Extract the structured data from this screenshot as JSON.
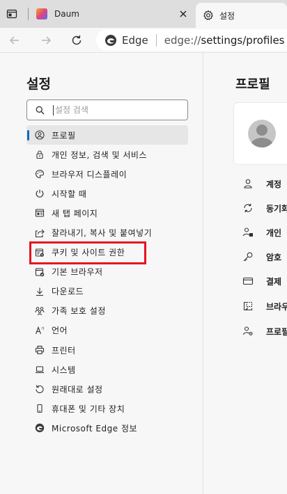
{
  "tabs": [
    {
      "title": "Daum"
    },
    {
      "title": "설정"
    }
  ],
  "address_bar": {
    "badge": "Edge",
    "url_scheme": "edge://",
    "url_rest": "settings/profiles"
  },
  "sidebar": {
    "title": "설정",
    "search_placeholder": "설정 검색",
    "items": [
      {
        "label": "프로필",
        "icon": "profile-icon",
        "active": true
      },
      {
        "label": "개인 정보, 검색 및 서비스",
        "icon": "lock-icon"
      },
      {
        "label": "브라우저 디스플레이",
        "icon": "palette-icon"
      },
      {
        "label": "시작할 때",
        "icon": "power-icon"
      },
      {
        "label": "새 탭 페이지",
        "icon": "new-tab-icon"
      },
      {
        "label": "잘라내기, 복사 및 붙여넣기",
        "icon": "share-icon"
      },
      {
        "label": "쿠키 및 사이트 권한",
        "icon": "site-permissions-icon",
        "highlighted": true
      },
      {
        "label": "기본 브라우저",
        "icon": "default-browser-icon"
      },
      {
        "label": "다운로드",
        "icon": "download-icon"
      },
      {
        "label": "가족 보호 설정",
        "icon": "family-icon"
      },
      {
        "label": "언어",
        "icon": "language-icon"
      },
      {
        "label": "프린터",
        "icon": "printer-icon"
      },
      {
        "label": "시스템",
        "icon": "laptop-icon"
      },
      {
        "label": "원래대로 설정",
        "icon": "reset-icon"
      },
      {
        "label": "휴대폰 및 기타 장치",
        "icon": "phone-icon"
      },
      {
        "label": "Microsoft Edge 정보",
        "icon": "edge-logo-icon"
      }
    ]
  },
  "content": {
    "title": "프로필",
    "rows": [
      {
        "label": "계정",
        "icon": "person-icon"
      },
      {
        "label": "동기화",
        "icon": "sync-icon"
      },
      {
        "label": "개인",
        "icon": "personal-info-icon"
      },
      {
        "label": "암호",
        "icon": "key-icon"
      },
      {
        "label": "결제",
        "icon": "card-icon"
      },
      {
        "label": "브라우",
        "icon": "import-icon"
      },
      {
        "label": "프로필",
        "icon": "profile-settings-icon"
      }
    ]
  },
  "colors": {
    "accent": "#0f6cbd",
    "highlight_box": "#e81123"
  }
}
